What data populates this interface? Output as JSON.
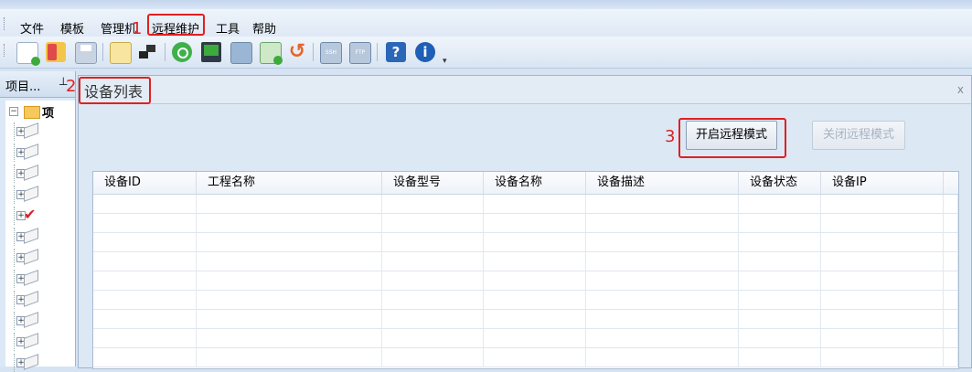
{
  "menubar": {
    "items": [
      "文件",
      "模板",
      "管理机",
      "远程维护",
      "工具",
      "帮助"
    ]
  },
  "toolbar": {
    "icons": [
      "new-file-icon",
      "open-icon",
      "save-icon",
      "book-icon",
      "network-icon",
      "refresh-green-icon",
      "monitor-check-icon",
      "monitor-icon",
      "add-device-icon",
      "reload-icon",
      "ssh-icon",
      "ftp-icon",
      "help-icon",
      "info-icon"
    ],
    "ssh_label": "SSH",
    "ftp_label": "FTP"
  },
  "left_panel": {
    "title": "项目...",
    "pin": "P",
    "root_label": "项"
  },
  "tab": {
    "title": "设备列表",
    "close": "x"
  },
  "buttons": {
    "open_remote": "开启远程模式",
    "close_remote": "关闭远程模式"
  },
  "table": {
    "columns": [
      "设备ID",
      "工程名称",
      "设备型号",
      "设备名称",
      "设备描述",
      "设备状态",
      "设备IP"
    ],
    "rows": []
  },
  "annotations": {
    "marker1": "1",
    "marker2": "2",
    "marker3": "3"
  },
  "colors": {
    "annotation_red": "#e02020",
    "panel_blue": "#dde8f5"
  }
}
